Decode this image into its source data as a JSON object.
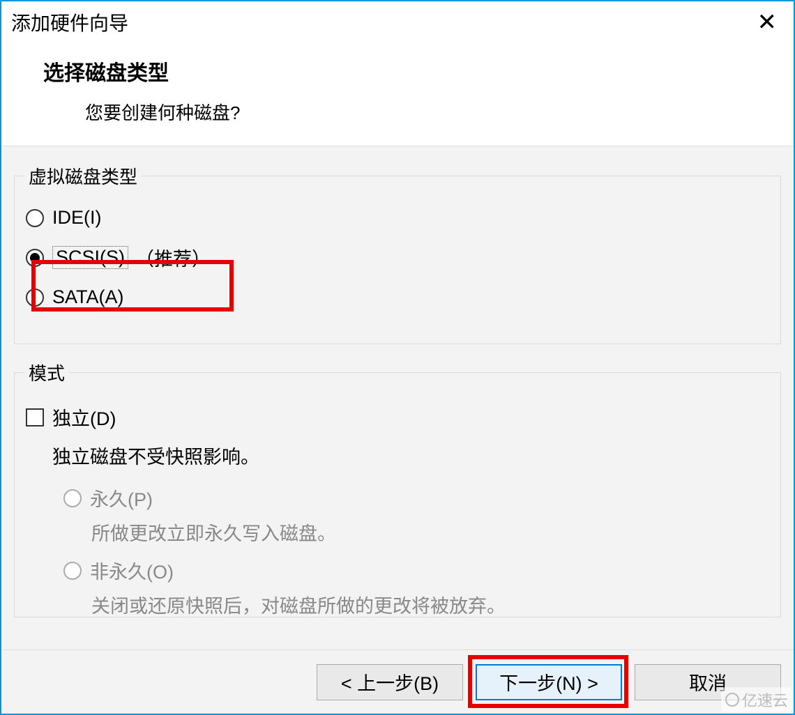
{
  "window": {
    "title": "添加硬件向导"
  },
  "header": {
    "title": "选择磁盘类型",
    "subtitle": "您要创建何种磁盘?"
  },
  "diskType": {
    "legend": "虚拟磁盘类型",
    "options": {
      "ide": "IDE(I)",
      "scsi": "SCSI(S)",
      "scsi_suffix": "（推荐）",
      "sata": "SATA(A)"
    },
    "selected": "scsi"
  },
  "mode": {
    "legend": "模式",
    "independent": "独立(D)",
    "independent_desc": "独立磁盘不受快照影响。",
    "permanent": "永久(P)",
    "permanent_desc": "所做更改立即永久写入磁盘。",
    "nonpermanent": "非永久(O)",
    "nonpermanent_desc": "关闭或还原快照后，对磁盘所做的更改将被放弃。"
  },
  "footer": {
    "back": "< 上一步(B)",
    "next": "下一步(N) >",
    "cancel": "取消"
  },
  "watermark": "亿速云"
}
